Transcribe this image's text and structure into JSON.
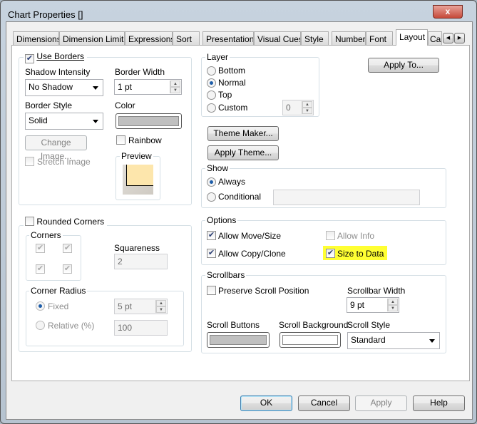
{
  "window": {
    "title": "Chart Properties []",
    "close": "x"
  },
  "tabs": [
    "Dimensions",
    "Dimension Limits",
    "Expressions",
    "Sort",
    "Presentation",
    "Visual Cues",
    "Style",
    "Number",
    "Font",
    "Layout",
    "Cap"
  ],
  "active_tab": "Layout",
  "borders": {
    "use_borders": "Use Borders",
    "shadow_label": "Shadow Intensity",
    "shadow_value": "No Shadow",
    "width_label": "Border Width",
    "width_value": "1 pt",
    "style_label": "Border Style",
    "style_value": "Solid",
    "color_label": "Color",
    "color_value": "#c0c0c0",
    "change_image": "Change Image...",
    "rainbow": "Rainbow",
    "stretch": "Stretch Image",
    "preview": "Preview"
  },
  "rounded": {
    "label": "Rounded Corners",
    "corners": "Corners",
    "squareness_label": "Squareness",
    "squareness_value": "2",
    "radius_label": "Corner Radius",
    "fixed": "Fixed",
    "fixed_value": "5 pt",
    "relative": "Relative (%)",
    "relative_value": "100"
  },
  "layer": {
    "label": "Layer",
    "options": [
      "Bottom",
      "Normal",
      "Top",
      "Custom"
    ],
    "selected": "Normal",
    "custom_value": "0"
  },
  "apply_to": "Apply To...",
  "theme_maker": "Theme Maker...",
  "apply_theme": "Apply Theme...",
  "show": {
    "label": "Show",
    "always": "Always",
    "conditional": "Conditional",
    "selected": "Always"
  },
  "options": {
    "label": "Options",
    "allow_move": "Allow Move/Size",
    "allow_copy": "Allow Copy/Clone",
    "allow_info": "Allow Info",
    "size_to_data": "Size to Data"
  },
  "scrollbars": {
    "label": "Scrollbars",
    "preserve": "Preserve Scroll Position",
    "width_label": "Scrollbar Width",
    "width_value": "9 pt",
    "buttons": "Scroll Buttons",
    "background": "Scroll Background",
    "style_label": "Scroll Style",
    "style_value": "Standard"
  },
  "footer": {
    "ok": "OK",
    "cancel": "Cancel",
    "apply": "Apply",
    "help": "Help"
  }
}
